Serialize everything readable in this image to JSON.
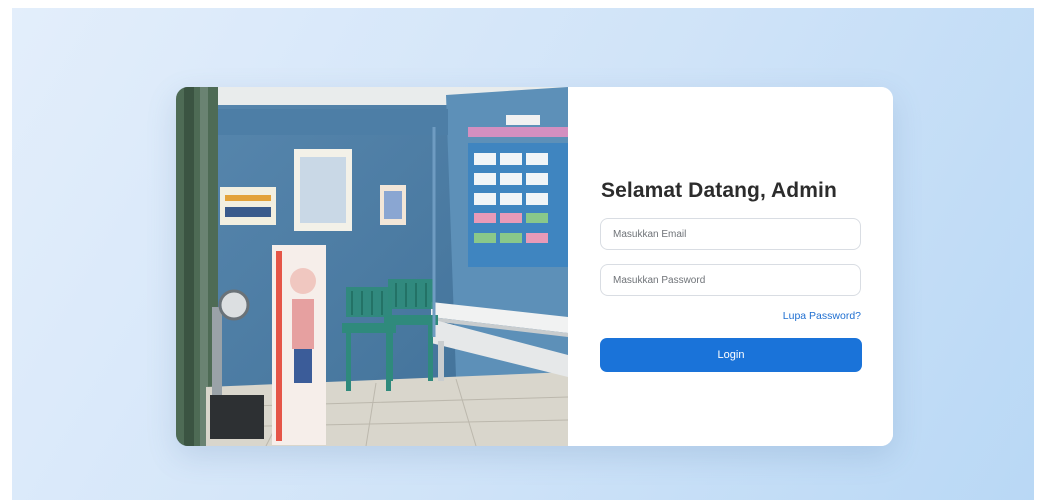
{
  "login": {
    "title": "Selamat Datang, Admin",
    "email_placeholder": "Masukkan Email",
    "password_placeholder": "Masukkan Password",
    "forgot_password": "Lupa Password?",
    "login_button": "Login"
  },
  "colors": {
    "primary": "#1a73d9",
    "link": "#1f6fd1",
    "title_text": "#2c2c2c",
    "background_gradient_start": "#e3eefb",
    "background_gradient_end": "#b9d8f5"
  }
}
